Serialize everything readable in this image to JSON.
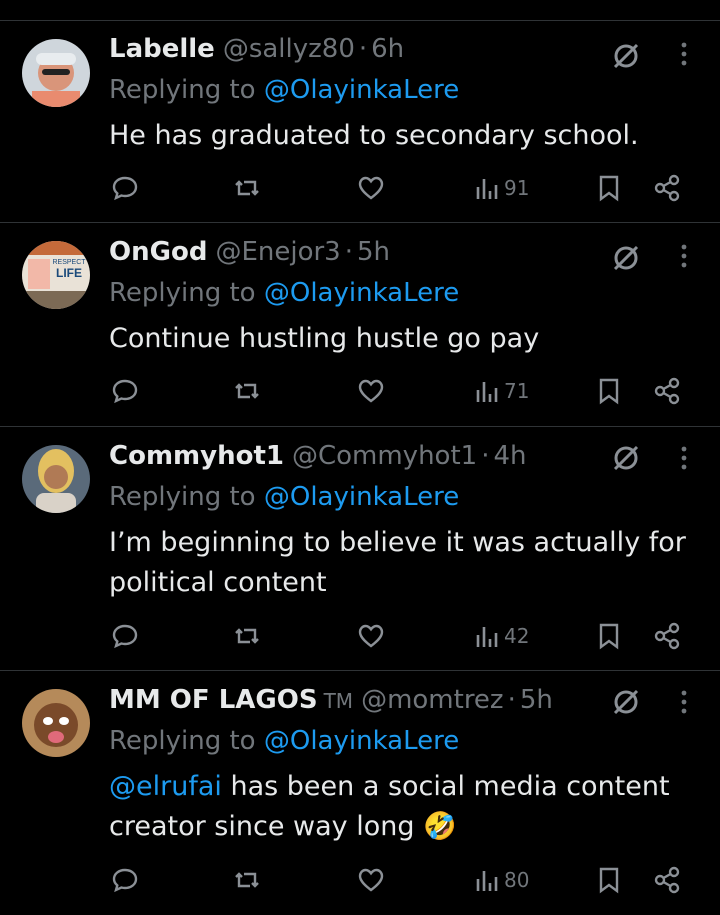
{
  "replies": [
    {
      "name": "Labelle",
      "tm": "",
      "handle": "@sallyz80",
      "dot": "·",
      "time": "6h",
      "replying_prefix": "Replying to",
      "replying_to": "@OlayinkaLere",
      "text_lines": [
        "He has graduated to secondary school."
      ],
      "mention": "",
      "emoji": "",
      "views": "91",
      "avatar": "avatar-person-cap"
    },
    {
      "name": "OnGod",
      "tm": "",
      "handle": "@Enejor3",
      "dot": "·",
      "time": "5h",
      "replying_prefix": "Replying to",
      "replying_to": "@OlayinkaLere",
      "text_lines": [
        "Continue hustling hustle go pay"
      ],
      "mention": "",
      "emoji": "",
      "views": "71",
      "avatar_text": [
        "RESPECT",
        "LIFE"
      ]
    },
    {
      "name": "Commyhot1",
      "tm": "",
      "handle": "@Commyhot1",
      "dot": "·",
      "time": "4h",
      "replying_prefix": "Replying to",
      "replying_to": "@OlayinkaLere",
      "text_lines": [
        "I’m beginning to believe it was actually for",
        "political content"
      ],
      "mention": "",
      "emoji": "",
      "views": "42",
      "avatar": "avatar-woman"
    },
    {
      "name": "MM OF LAGOS",
      "tm": "TM",
      "handle": "@momtrez",
      "dot": "·",
      "time": "5h",
      "replying_prefix": "Replying to",
      "replying_to": "@OlayinkaLere",
      "mention": "@elrufai",
      "text_lines": [
        " has been a social media content",
        "creator since way long"
      ],
      "emoji": "🤣",
      "views": "80",
      "avatar": "avatar-child"
    }
  ],
  "colors": {
    "background": "#000000",
    "text": "#e7e9ea",
    "muted": "#71767b",
    "link": "#1d9bf0",
    "divider": "#2f3336"
  },
  "icons": [
    "grok-icon",
    "more-icon",
    "reply-icon",
    "retweet-icon",
    "like-icon",
    "views-icon",
    "bookmark-icon",
    "share-icon"
  ]
}
